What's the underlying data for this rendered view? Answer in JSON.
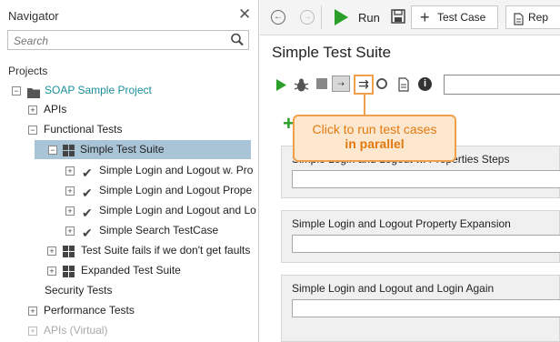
{
  "navigator": {
    "title": "Navigator",
    "search_placeholder": "Search",
    "projects_label": "Projects",
    "tree": [
      {
        "label": "SOAP Sample Project"
      },
      {
        "label": "APIs"
      },
      {
        "label": "Functional Tests"
      },
      {
        "label": "Simple Test Suite",
        "selected": true
      },
      {
        "label": "Simple Login and Logout w. Pro"
      },
      {
        "label": "Simple Login and Logout Prope"
      },
      {
        "label": "Simple Login and Logout and Lo"
      },
      {
        "label": "Simple Search TestCase"
      },
      {
        "label": "Test Suite fails if we don't get faults"
      },
      {
        "label": "Expanded Test Suite"
      },
      {
        "label": "Security Tests"
      },
      {
        "label": "Performance Tests"
      },
      {
        "label": "APIs (Virtual)"
      }
    ]
  },
  "toolbar": {
    "run_label": "Run",
    "test_case_label": "Test Case",
    "report_label": "Rep"
  },
  "suite": {
    "title": "Simple Test Suite",
    "callout_line1": "Click to run test cases",
    "callout_line2": "in parallel",
    "cases": [
      {
        "title": "Simple Login and Logout w. Properties Steps"
      },
      {
        "title": "Simple Login and Logout Property Expansion"
      },
      {
        "title": "Simple Login and Logout and Login Again"
      }
    ]
  },
  "colors": {
    "accent_green": "#2aa02a",
    "project_teal": "#1b8f9a",
    "callout_orange": "#f0a04a",
    "selection": "#a9c4d6"
  }
}
